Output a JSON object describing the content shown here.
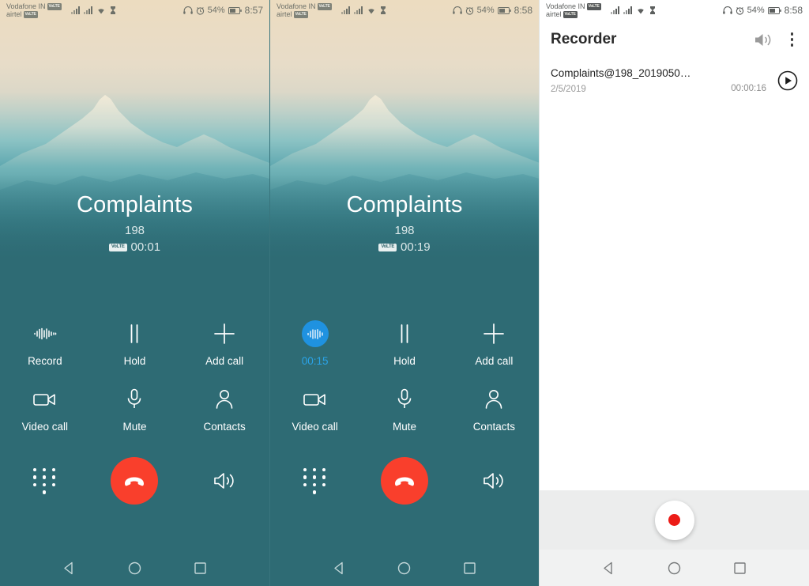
{
  "panels": [
    {
      "type": "call",
      "status_bar": {
        "carrier_primary": "Vodafone IN",
        "carrier_primary_badge": "VoLTE",
        "carrier_secondary": "airtel",
        "carrier_secondary_badge": "VoLTE",
        "battery_percent": "54%",
        "clock": "8:57",
        "icons": [
          "signal-bars-icon",
          "signal-bars-icon",
          "wifi-icon",
          "hourglass-icon",
          "headset-icon",
          "alarm-icon",
          "battery-icon"
        ]
      },
      "call": {
        "contact_name": "Complaints",
        "contact_number": "198",
        "volte_badge": "VoLTE",
        "duration": "00:01"
      },
      "buttons": [
        {
          "id": "record",
          "label": "Record",
          "icon": "waveform-icon",
          "active": false
        },
        {
          "id": "hold",
          "label": "Hold",
          "icon": "pause-icon",
          "active": false
        },
        {
          "id": "add-call",
          "label": "Add call",
          "icon": "plus-icon",
          "active": false
        },
        {
          "id": "video-call",
          "label": "Video call",
          "icon": "video-camera-icon",
          "active": false
        },
        {
          "id": "mute",
          "label": "Mute",
          "icon": "microphone-icon",
          "active": false
        },
        {
          "id": "contacts",
          "label": "Contacts",
          "icon": "person-icon",
          "active": false
        }
      ],
      "bottom": {
        "keypad": "dialpad-icon",
        "end_call": "end-call-icon",
        "speaker": "speaker-icon"
      }
    },
    {
      "type": "call",
      "status_bar": {
        "carrier_primary": "Vodafone IN",
        "carrier_primary_badge": "VoLTE",
        "carrier_secondary": "airtel",
        "carrier_secondary_badge": "VoLTE",
        "battery_percent": "54%",
        "clock": "8:58",
        "icons": [
          "signal-bars-icon",
          "signal-bars-icon",
          "wifi-icon",
          "hourglass-icon",
          "headset-icon",
          "alarm-icon",
          "battery-icon"
        ]
      },
      "call": {
        "contact_name": "Complaints",
        "contact_number": "198",
        "volte_badge": "VoLTE",
        "duration": "00:19"
      },
      "buttons": [
        {
          "id": "record",
          "label": "00:15",
          "icon": "waveform-icon",
          "active": true
        },
        {
          "id": "hold",
          "label": "Hold",
          "icon": "pause-icon",
          "active": false
        },
        {
          "id": "add-call",
          "label": "Add call",
          "icon": "plus-icon",
          "active": false
        },
        {
          "id": "video-call",
          "label": "Video call",
          "icon": "video-camera-icon",
          "active": false
        },
        {
          "id": "mute",
          "label": "Mute",
          "icon": "microphone-icon",
          "active": false
        },
        {
          "id": "contacts",
          "label": "Contacts",
          "icon": "person-icon",
          "active": false
        }
      ],
      "bottom": {
        "keypad": "dialpad-icon",
        "end_call": "end-call-icon",
        "speaker": "speaker-icon"
      }
    },
    {
      "type": "recorder",
      "status_bar": {
        "carrier_primary": "Vodafone IN",
        "carrier_primary_badge": "VoLTE",
        "carrier_secondary": "airtel",
        "carrier_secondary_badge": "VoLTE",
        "battery_percent": "54%",
        "clock": "8:58",
        "icons": [
          "signal-bars-icon",
          "signal-bars-icon",
          "wifi-icon",
          "hourglass-icon",
          "headset-icon",
          "alarm-icon",
          "battery-icon"
        ]
      },
      "header": {
        "title": "Recorder",
        "speaker_icon": "speaker-icon",
        "overflow_icon": "more-vertical-icon"
      },
      "recordings": [
        {
          "title": "Complaints@198_2019050…",
          "date": "2/5/2019",
          "duration": "00:00:16",
          "play_icon": "play-circle-icon"
        }
      ],
      "footer": {
        "record_button": "record-button"
      }
    }
  ],
  "navigation": {
    "back": "back-triangle-icon",
    "home": "home-circle-icon",
    "recents": "recents-square-icon"
  },
  "colors": {
    "call_background": "#2e6b74",
    "end_call_red": "#f93f2c",
    "recording_blue": "#1f92e0",
    "record_dot_red": "#ec1c17",
    "recorder_footer": "#eceded"
  }
}
